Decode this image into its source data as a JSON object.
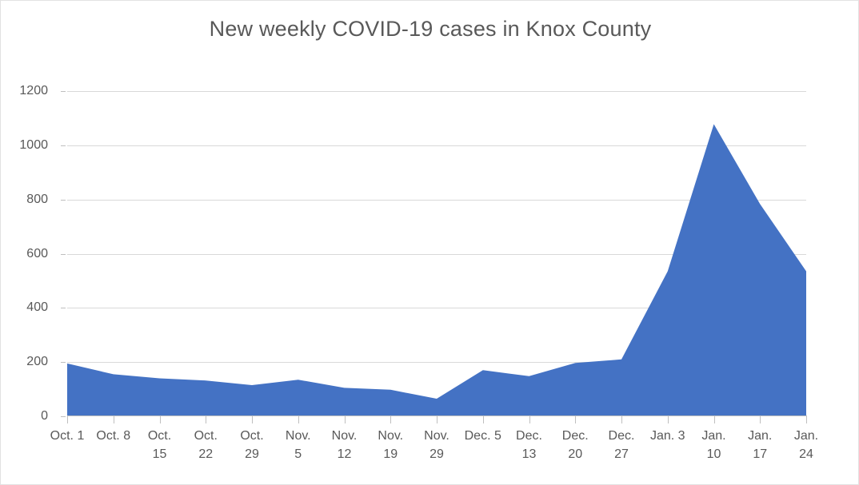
{
  "chart_data": {
    "type": "area",
    "title": "New weekly COVID-19 cases in Knox County",
    "xlabel": "",
    "ylabel": "",
    "ylim": [
      0,
      1200
    ],
    "yticks": [
      0,
      200,
      400,
      600,
      800,
      1000,
      1200
    ],
    "grid": true,
    "legend": "none",
    "series_color": "#4472c4",
    "categories": [
      "Oct. 1",
      "Oct. 8",
      "Oct. 15",
      "Oct. 22",
      "Oct. 29",
      "Nov. 5",
      "Nov. 12",
      "Nov. 19",
      "Nov. 29",
      "Dec. 5",
      "Dec. 13",
      "Dec. 20",
      "Dec. 27",
      "Jan. 3",
      "Jan. 10",
      "Jan. 17",
      "Jan. 24"
    ],
    "values": [
      195,
      155,
      140,
      132,
      115,
      135,
      105,
      98,
      65,
      170,
      148,
      197,
      210,
      535,
      1078,
      783,
      535
    ]
  }
}
